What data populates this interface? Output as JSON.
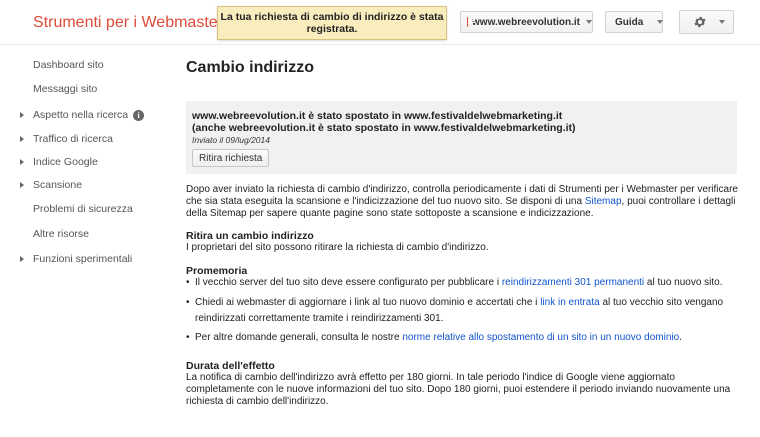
{
  "header": {
    "app_title": "Strumenti per i Webmaster",
    "notice": "La tua richiesta di cambio di indirizzo è stata registrata.",
    "site_selector": "www.webreevolution.it",
    "help_label": "Guida",
    "settings_icon": "gear-icon"
  },
  "sidebar": {
    "items": [
      {
        "label": "Dashboard sito",
        "expandable": false
      },
      {
        "label": "Messaggi sito",
        "expandable": false
      },
      {
        "label": "Aspetto nella ricerca",
        "expandable": true,
        "info_icon": true
      },
      {
        "label": "Traffico di ricerca",
        "expandable": true
      },
      {
        "label": "Indice Google",
        "expandable": true
      },
      {
        "label": "Scansione",
        "expandable": true
      },
      {
        "label": "Problemi di sicurezza",
        "expandable": false
      },
      {
        "label": "Altre risorse",
        "expandable": false
      },
      {
        "label": "Funzioni sperimentali",
        "expandable": true
      }
    ]
  },
  "main": {
    "title": "Cambio indirizzo",
    "status": {
      "line1": "www.webreevolution.it è stato spostato in www.festivaldelwebmarketing.it",
      "line2": "(anche webreevolution.it è stato spostato in www.festivaldelwebmarketing.it)",
      "date": "Inviato il 09/lug/2014",
      "button": "Ritira richiesta"
    },
    "intro": {
      "before": "Dopo aver inviato la richiesta di cambio d'indirizzo, controlla periodicamente i dati di Strumenti per i Webmaster per verificare che sia stata eseguita la scansione e l'indicizzazione del tuo nuovo sito. Se disponi di una ",
      "link": "Sitemap",
      "after": ", puoi controllare i dettagli della Sitemap per sapere quante pagine sono state sottoposte a scansione e indicizzazione."
    },
    "withdraw": {
      "heading": "Ritira un cambio indirizzo",
      "text": "I proprietari del sito possono ritirare la richiesta di cambio d'indirizzo."
    },
    "reminder": {
      "heading": "Promemoria",
      "b1_before": "Il vecchio server del tuo sito deve essere configurato per pubblicare i ",
      "b1_link": "reindirizzamenti 301 permanenti",
      "b1_after": " al tuo nuovo sito.",
      "b2_before": "Chiedi ai webmaster di aggiornare i link al tuo nuovo dominio e accertati che i ",
      "b2_link": "link in entrata",
      "b2_after": " al tuo vecchio sito vengano reindirizzati correttamente tramite i reindirizzamenti 301.",
      "b3_before": "Per altre domande generali, consulta le nostre ",
      "b3_link": "norme relative allo spostamento di un sito in un nuovo dominio",
      "b3_after": "."
    },
    "duration": {
      "heading": "Durata dell'effetto",
      "text": "La notifica di cambio dell'indirizzo avrà effetto per 180 giorni. In tale periodo l'indice di Google viene aggiornato completamente con le nuove informazioni del tuo sito. Dopo 180 giorni, puoi estendere il periodo inviando nuovamente una richiesta di cambio dell'indirizzo."
    }
  }
}
